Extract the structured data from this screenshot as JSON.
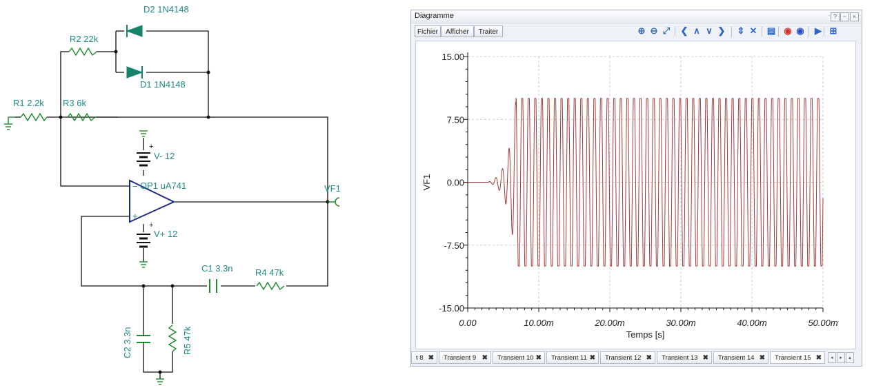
{
  "schematic": {
    "labels": {
      "d2": "D2 1N4148",
      "d1": "D1 1N4148",
      "r2": "R2 22k",
      "r1": "R1 2.2k",
      "r3": "R3 6k",
      "vminus": "V- 12",
      "op1": "OP1 uA741",
      "vf1": "VF1",
      "vplus": "V+ 12",
      "c1": "C1 3.3n",
      "r4": "R4 47k",
      "c2": "C2 3.3n",
      "r5": "R5 47k",
      "minus_pin": "−",
      "plus_pin": "+"
    }
  },
  "window": {
    "title": "Diagramme",
    "buttons": {
      "help": "?",
      "minimize": "−",
      "close": "×"
    }
  },
  "toolbar": {
    "menus": [
      "Fichier",
      "Afficher",
      "Traiter"
    ],
    "icons": [
      {
        "name": "zoom-in-icon",
        "glyph": "⊕",
        "color": "#3b6fb6"
      },
      {
        "name": "zoom-out-icon",
        "glyph": "⊖",
        "color": "#3b6fb6"
      },
      {
        "name": "fit-icon",
        "glyph": "⤢",
        "color": "#3b6fb6"
      },
      {
        "name": "arrow-left-icon",
        "glyph": "❮",
        "color": "#2f66c8"
      },
      {
        "name": "arrow-up-icon",
        "glyph": "∧",
        "color": "#2f66c8"
      },
      {
        "name": "arrow-down-icon",
        "glyph": "∨",
        "color": "#2f66c8"
      },
      {
        "name": "arrow-right-icon",
        "glyph": "❯",
        "color": "#2f66c8"
      },
      {
        "name": "expand-vertical-icon",
        "glyph": "⇕",
        "color": "#2f66c8"
      },
      {
        "name": "cross-icon",
        "glyph": "✕",
        "color": "#2f66c8"
      },
      {
        "name": "comment-icon",
        "glyph": "▤",
        "color": "#2f66c8"
      },
      {
        "name": "marker-a-icon",
        "glyph": "◉",
        "color": "#d0322c"
      },
      {
        "name": "marker-b-icon",
        "glyph": "◉",
        "color": "#2f4fc8"
      },
      {
        "name": "play-icon",
        "glyph": "▶",
        "color": "#2f66c8"
      },
      {
        "name": "add-window-icon",
        "glyph": "⊞",
        "color": "#2f66c8"
      }
    ]
  },
  "chart_data": {
    "type": "line",
    "xlabel": "Temps [s]",
    "ylabel": "VF1",
    "xlim": [
      0,
      0.05
    ],
    "ylim": [
      -15,
      15
    ],
    "xticks": [
      "0.00",
      "10.00m",
      "20.00m",
      "30.00m",
      "40.00m",
      "50.00m"
    ],
    "yticks": [
      "15.00",
      "7.50",
      "0.00",
      "-7.50",
      "-15.00"
    ],
    "grid": true,
    "series": [
      {
        "color": "#a13a3a",
        "description": "oscillation growing from 0 at ~3ms, saturating at about +/-10 by ~7ms, frequency about 1.08 kHz",
        "start_time": 0.0028,
        "saturation_time": 0.0068,
        "amplitude": 10,
        "frequency_hz": 1080
      }
    ]
  },
  "tabs": {
    "items": [
      "t 8",
      "Transient 9",
      "Transient 10",
      "Transient 11",
      "Transient 12",
      "Transient 13",
      "Transient 14",
      "Transient 15"
    ],
    "active": "Transient 15",
    "close_glyph": "✖",
    "nav": [
      "◂",
      "▸",
      "▴"
    ]
  }
}
